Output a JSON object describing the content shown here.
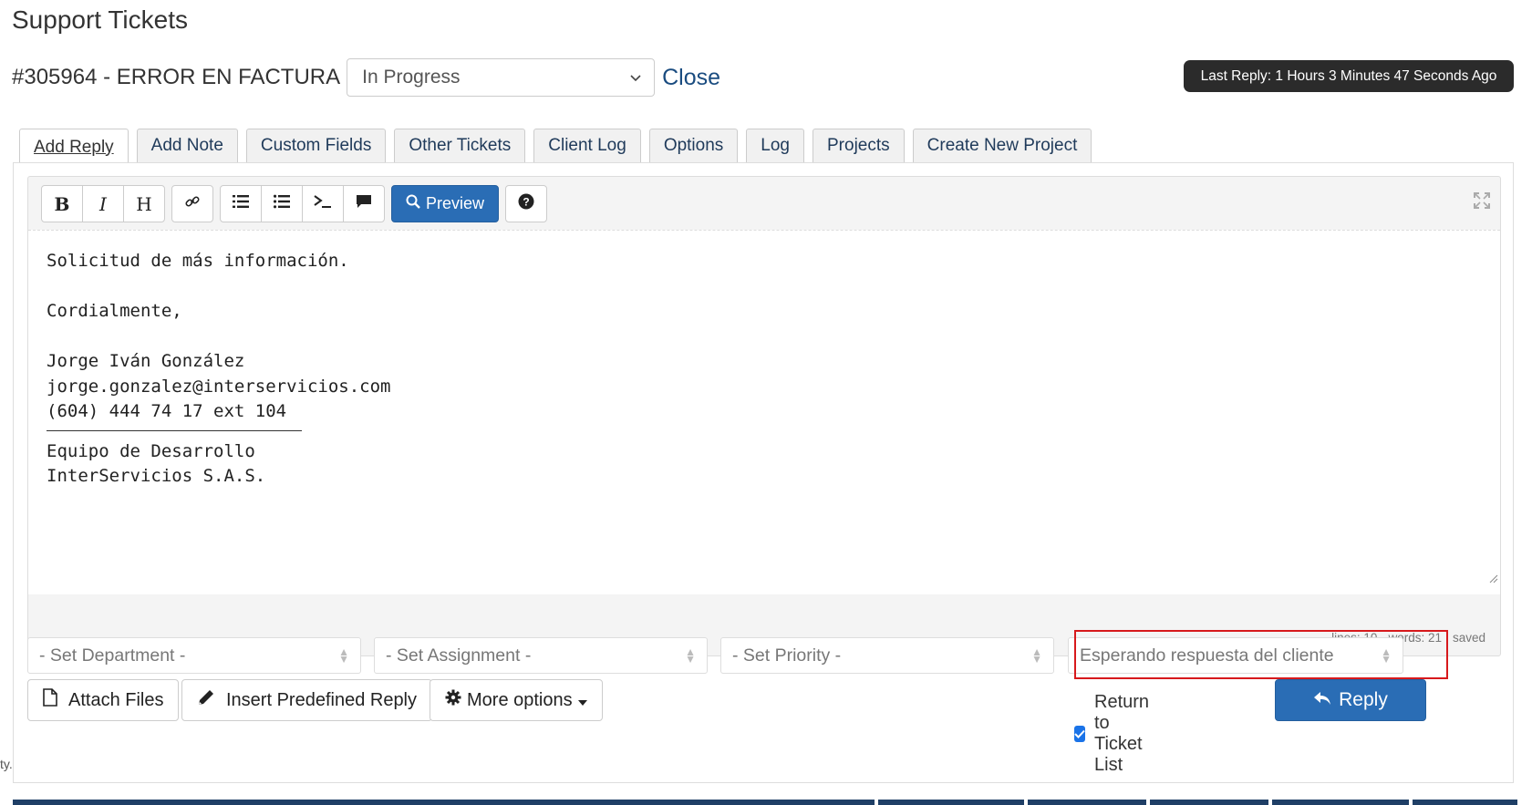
{
  "page": {
    "title": "Support Tickets"
  },
  "ticket": {
    "heading": "#305964 - ERROR EN FACTURA",
    "status_value": "In Progress",
    "close_label": "Close",
    "last_reply": "Last Reply: 1 Hours 3 Minutes 47 Seconds Ago"
  },
  "tabs": [
    {
      "label": "Add Reply",
      "active": true
    },
    {
      "label": "Add Note"
    },
    {
      "label": "Custom Fields"
    },
    {
      "label": "Other Tickets"
    },
    {
      "label": "Client Log"
    },
    {
      "label": "Options"
    },
    {
      "label": "Log"
    },
    {
      "label": "Projects"
    },
    {
      "label": "Create New Project"
    }
  ],
  "toolbar": {
    "bold": "B",
    "italic": "I",
    "heading": "H",
    "preview_label": "Preview",
    "icons": [
      "link-icon",
      "ordered-list-icon",
      "unordered-list-icon",
      "code-icon",
      "quote-icon",
      "search-icon",
      "help-icon",
      "fullscreen-icon"
    ]
  },
  "editor": {
    "lines": [
      "Solicitud de más información.",
      "",
      "Cordialmente,",
      "",
      "Jorge Iván González",
      "jorge.gonzalez@interservicios.com",
      "(604) 444 74 17 ext 104"
    ],
    "lines_after_rule": [
      "Equipo de Desarrollo",
      "InterServicios S.A.S."
    ],
    "stats": {
      "lines": "lines: 10",
      "words": "words: 21",
      "saved": "saved"
    }
  },
  "selects": {
    "department": "- Set Department -",
    "assignment": "- Set Assignment -",
    "priority": "- Set Priority -",
    "status": "Esperando respuesta del cliente"
  },
  "actions": {
    "attach_files": "Attach Files",
    "insert_predefined": "Insert Predefined Reply",
    "more_options": "More options",
    "return_to_list": "Return to Ticket List",
    "return_checked": true,
    "reply": "Reply"
  },
  "left_fragment": "ty.",
  "colors": {
    "primary": "#2a6db5",
    "link": "#1a4c80",
    "highlight": "#d7191c",
    "badge_bg": "#2b2b2b"
  }
}
